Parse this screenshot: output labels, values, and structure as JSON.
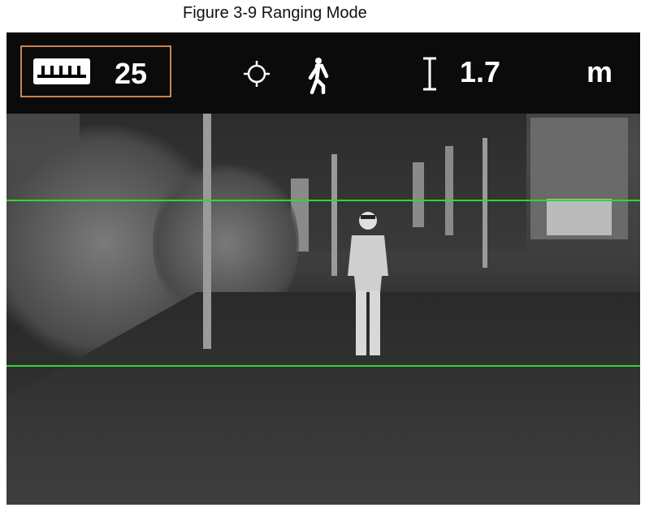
{
  "caption": "Figure 3-9 Ranging Mode",
  "topbar": {
    "zoom_value": "25",
    "height_value": "1.7",
    "unit": "m"
  },
  "icons": [
    "ruler-icon",
    "crosshair-icon",
    "walking-person-icon",
    "height-icon"
  ],
  "colors": {
    "highlight": "#c98550",
    "range_lines": "#2fd82f"
  }
}
